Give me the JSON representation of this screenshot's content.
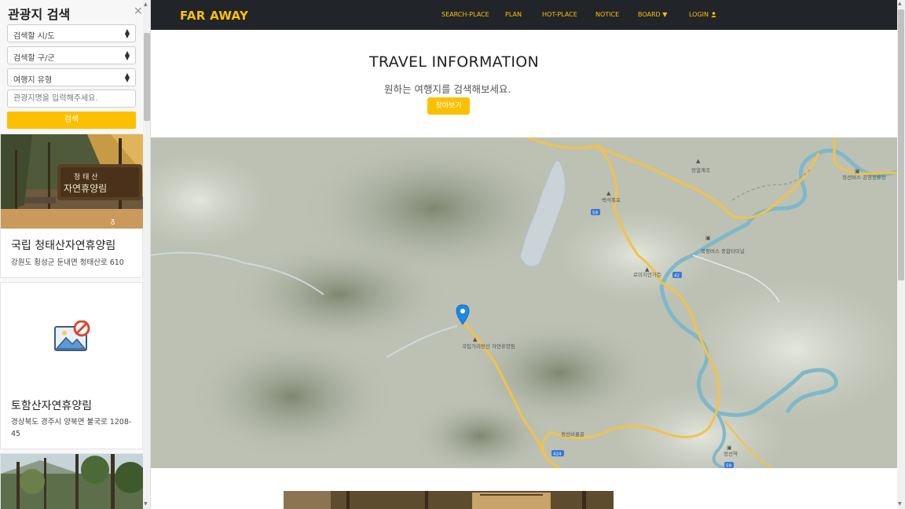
{
  "sidebar": {
    "title": "관광지 검색",
    "close_glyph": "×",
    "select_sido": "검색할 시/도",
    "select_gugun": "검색할 구/군",
    "select_type": "여행지 유형",
    "keyword_placeholder": "관광지명을 입력해주세요.",
    "search_button": "검색",
    "cards": [
      {
        "title": "국립 청태산자연휴양림",
        "address": "강원도 횡성군 둔내면 청태산로 610"
      },
      {
        "title": "토함산자연휴양림",
        "address": "경상북도 경주시 양북면 불국로 1208-45"
      }
    ],
    "card1_sign": "청태산 자연휴양림",
    "no_image_icon": "no-image-icon"
  },
  "navbar": {
    "brand": "FAR AWAY",
    "links": {
      "search_place": "SEARCH-PLACE",
      "plan": "PLAN",
      "hot_place": "HOT-PLACE",
      "notice": "NOTICE",
      "board": "BOARD",
      "login": "LOGIN"
    }
  },
  "main": {
    "title": "TRAVEL INFORMATION",
    "subtitle": "원하는 여행지를 검색해보세요.",
    "button": "찾아보기"
  },
  "map": {
    "marker_label": "국립가리왕산 자연휴양림",
    "places": {
      "jangyeol": "장열계곡",
      "jeongseon_station": "정선역",
      "jeongseon_bus": "정선버스 공영정류장",
      "byeolam": "북평버스 종합터미널",
      "rose_garden": "로미지안가든",
      "baekseok": "백석폭포",
      "jeongseon_bimok": "정선비룡골"
    },
    "roads": [
      "59",
      "42",
      "424",
      "59"
    ]
  },
  "colors": {
    "accent": "#fcc000",
    "navbar_bg": "#212529",
    "road": "#f2c24a",
    "river": "#7fb8c8",
    "marker": "#1e88e5"
  }
}
